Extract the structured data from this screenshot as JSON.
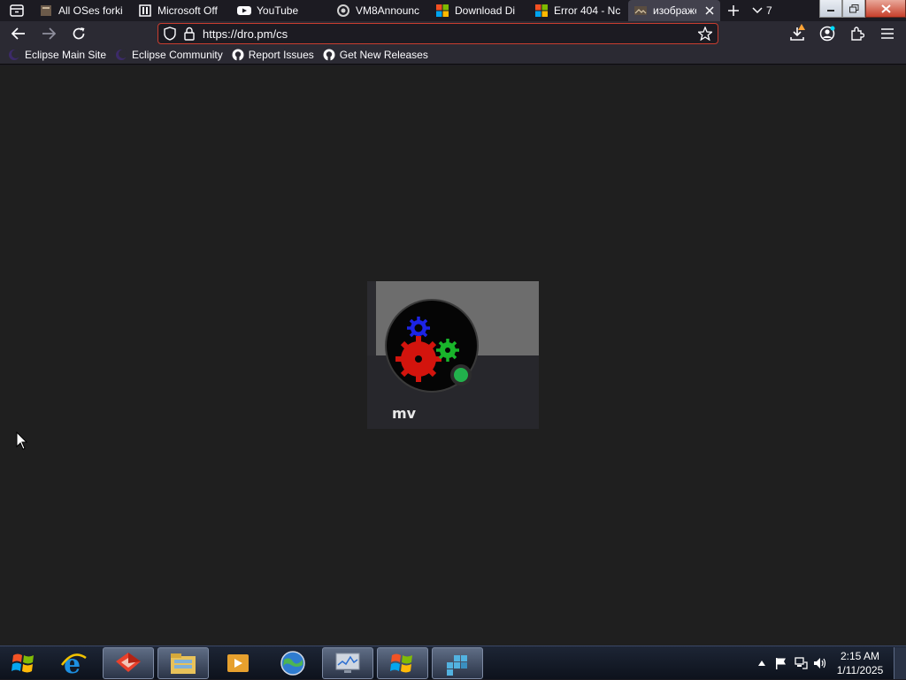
{
  "browser": {
    "tabs": [
      {
        "label": "All OSes forki",
        "icon": "page-favicon-icon",
        "active": false
      },
      {
        "label": "Microsoft Off",
        "icon": "office-favicon-icon",
        "active": false
      },
      {
        "label": "YouTube",
        "icon": "youtube-icon",
        "active": false
      },
      {
        "label": "VM8Announc",
        "icon": "vm8-favicon-icon",
        "active": false
      },
      {
        "label": "Download Di",
        "icon": "microsoft-logo-icon",
        "active": false
      },
      {
        "label": "Error 404 - Nc",
        "icon": "microsoft-logo-icon",
        "active": false
      },
      {
        "label": "изображе",
        "icon": "image-favicon-icon",
        "active": true
      }
    ],
    "tab_overflow_count": "7",
    "url": "https://dro.pm/cs",
    "bookmarks": [
      {
        "label": "Eclipse Main Site",
        "icon": "eclipse-icon"
      },
      {
        "label": "Eclipse Community",
        "icon": "eclipse-icon"
      },
      {
        "label": "Report Issues",
        "icon": "github-icon"
      },
      {
        "label": "Get New Releases",
        "icon": "github-icon"
      }
    ]
  },
  "content": {
    "image_caption": "mv"
  },
  "taskbar": {
    "apps": [
      "internet-explorer-icon",
      "3d-app-icon",
      "file-explorer-icon",
      "media-player-icon",
      "globe-app-icon",
      "monitor-app-icon",
      "windows-logo-icon",
      "registry-icon"
    ],
    "time": "2:15 AM",
    "date": "1/11/2025"
  },
  "colors": {
    "accent_url_border": "#c83d2f",
    "tab_active": "#42414d",
    "toolbar": "#2b2a33",
    "content_bg": "#1f1f1f"
  }
}
